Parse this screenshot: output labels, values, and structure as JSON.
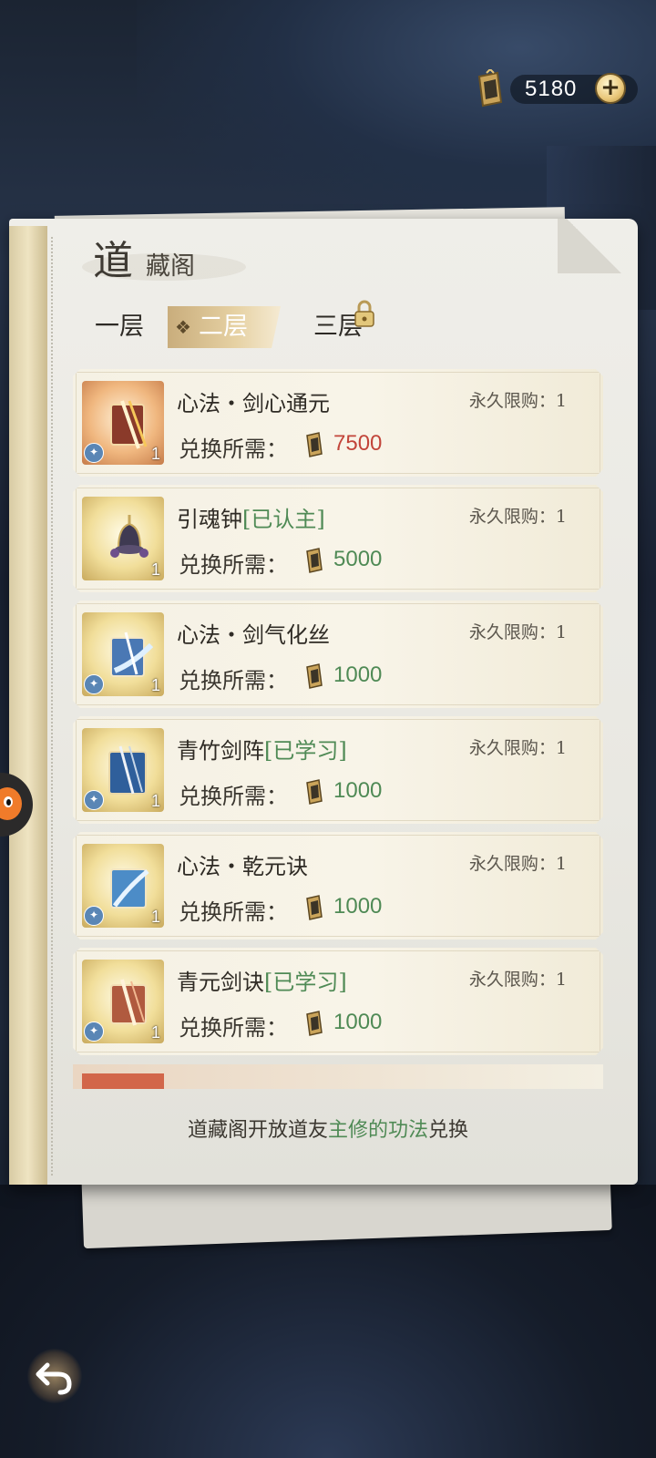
{
  "currency": {
    "amount": "5180",
    "plus": "+"
  },
  "header": {
    "title_big": "道",
    "title_small": "藏阁"
  },
  "tabs": [
    {
      "label": "一层"
    },
    {
      "label": "二层",
      "marker": "❖"
    },
    {
      "label": "三层"
    }
  ],
  "items": [
    {
      "name": "心法・剑心通元",
      "tag": "",
      "limit_label": "永久限购：",
      "limit": "1",
      "cost_label": "兑换所需：",
      "cost": "7500",
      "count": "1"
    },
    {
      "name": "引魂钟",
      "tag": "[已认主]",
      "limit_label": "永久限购：",
      "limit": "1",
      "cost_label": "兑换所需：",
      "cost": "5000",
      "count": "1"
    },
    {
      "name": "心法・剑气化丝",
      "tag": "",
      "limit_label": "永久限购：",
      "limit": "1",
      "cost_label": "兑换所需：",
      "cost": "1000",
      "count": "1"
    },
    {
      "name": "青竹剑阵",
      "tag": "[已学习]",
      "limit_label": "永久限购：",
      "limit": "1",
      "cost_label": "兑换所需：",
      "cost": "1000",
      "count": "1"
    },
    {
      "name": "心法・乾元诀",
      "tag": "",
      "limit_label": "永久限购：",
      "limit": "1",
      "cost_label": "兑换所需：",
      "cost": "1000",
      "count": "1"
    },
    {
      "name": "青元剑诀",
      "tag": "[已学习]",
      "limit_label": "永久限购：",
      "limit": "1",
      "cost_label": "兑换所需：",
      "cost": "1000",
      "count": "1"
    }
  ],
  "footer": {
    "part1": "道藏阁开放道友",
    "highlight": "主修的功法",
    "part2": "兑换"
  },
  "colors": {
    "price_insufficient": "#c2453a",
    "price_ok": "#4f8a55",
    "tab_active": "#d8bf8f"
  },
  "icons": {
    "currency": "token-icon",
    "lock": "lock-icon",
    "back": "back-arrow-icon"
  }
}
